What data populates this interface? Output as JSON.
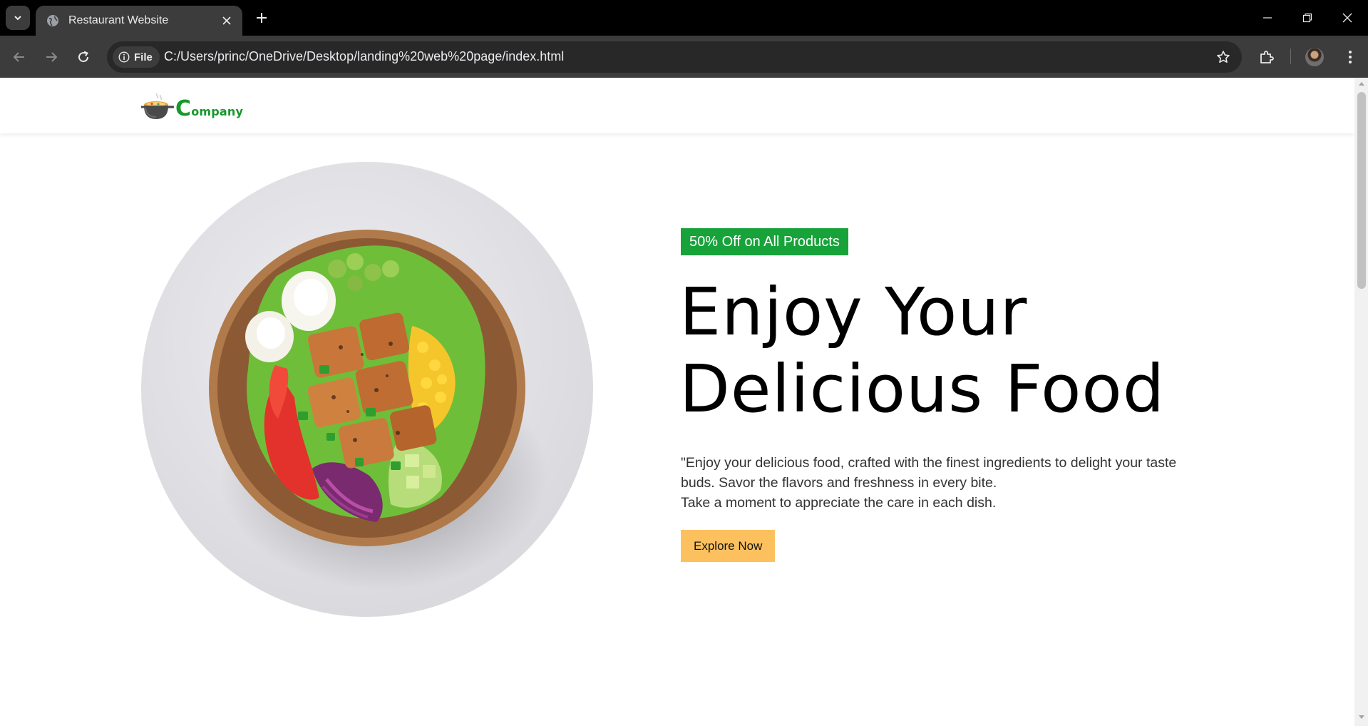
{
  "browser": {
    "tab_title": "Restaurant Website",
    "url": "C:/Users/princ/OneDrive/Desktop/landing%20web%20page/index.html",
    "site_chip_label": "File"
  },
  "site": {
    "logo_text_initial": "C",
    "logo_text_rest": "ompany",
    "brand_color": "#17982c"
  },
  "hero": {
    "badge": "50% Off on All Products",
    "headline_line1": "Enjoy Your",
    "headline_line2": "Delicious Food",
    "description_line1": "\"Enjoy your delicious food, crafted with the finest ingredients to delight your taste buds. Savor the flavors and freshness in every bite.",
    "description_line2": "Take a moment to appreciate the care in each dish.",
    "cta_label": "Explore Now",
    "badge_color": "#17a33a",
    "cta_color": "#fcc15e"
  }
}
